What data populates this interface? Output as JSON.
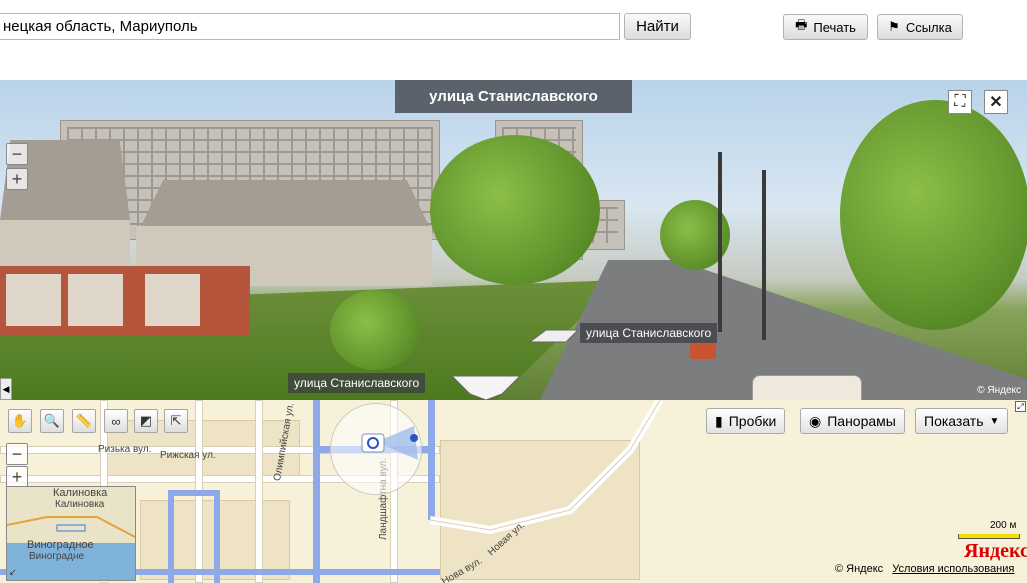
{
  "search": {
    "value": "нецкая область, Мариуполь",
    "find_label": "Найти"
  },
  "actions": {
    "print_label": "Печать",
    "link_label": "Ссылка"
  },
  "panorama": {
    "title": "улица Станиславского",
    "label_right": "улица Станиславского",
    "label_left": "улица Станиславского",
    "copyright": "© Яндекс",
    "fullscreen_icon": "fullscreen-icon",
    "close_icon": "close-icon"
  },
  "map": {
    "tools": [
      "hand-icon",
      "magnifier-icon",
      "ruler-icon",
      "route-icon",
      "placemark-icon",
      "select-icon"
    ],
    "traffic_label": "Пробки",
    "panoramas_label": "Панорамы",
    "show_label": "Показать",
    "scale_label": "200 м",
    "logo": "Яндекс",
    "copyright": "© Яндекс",
    "terms_label": "Условия использования",
    "streets": {
      "rizka": "Ризька вул.",
      "rizhskaya": "Рижская ул.",
      "olimpiyska": "Олимпийская ул.",
      "landshaftna": "Ландшафтна вул.",
      "nova_ul": "Новая ул.",
      "nova_vul": "Нова вул."
    },
    "minimap": {
      "kalinovka1": "Калиновка",
      "kalinovka2": "Калиновка",
      "vinogradnoe": "Виноградное",
      "vinogradne": "Виноградне"
    }
  }
}
